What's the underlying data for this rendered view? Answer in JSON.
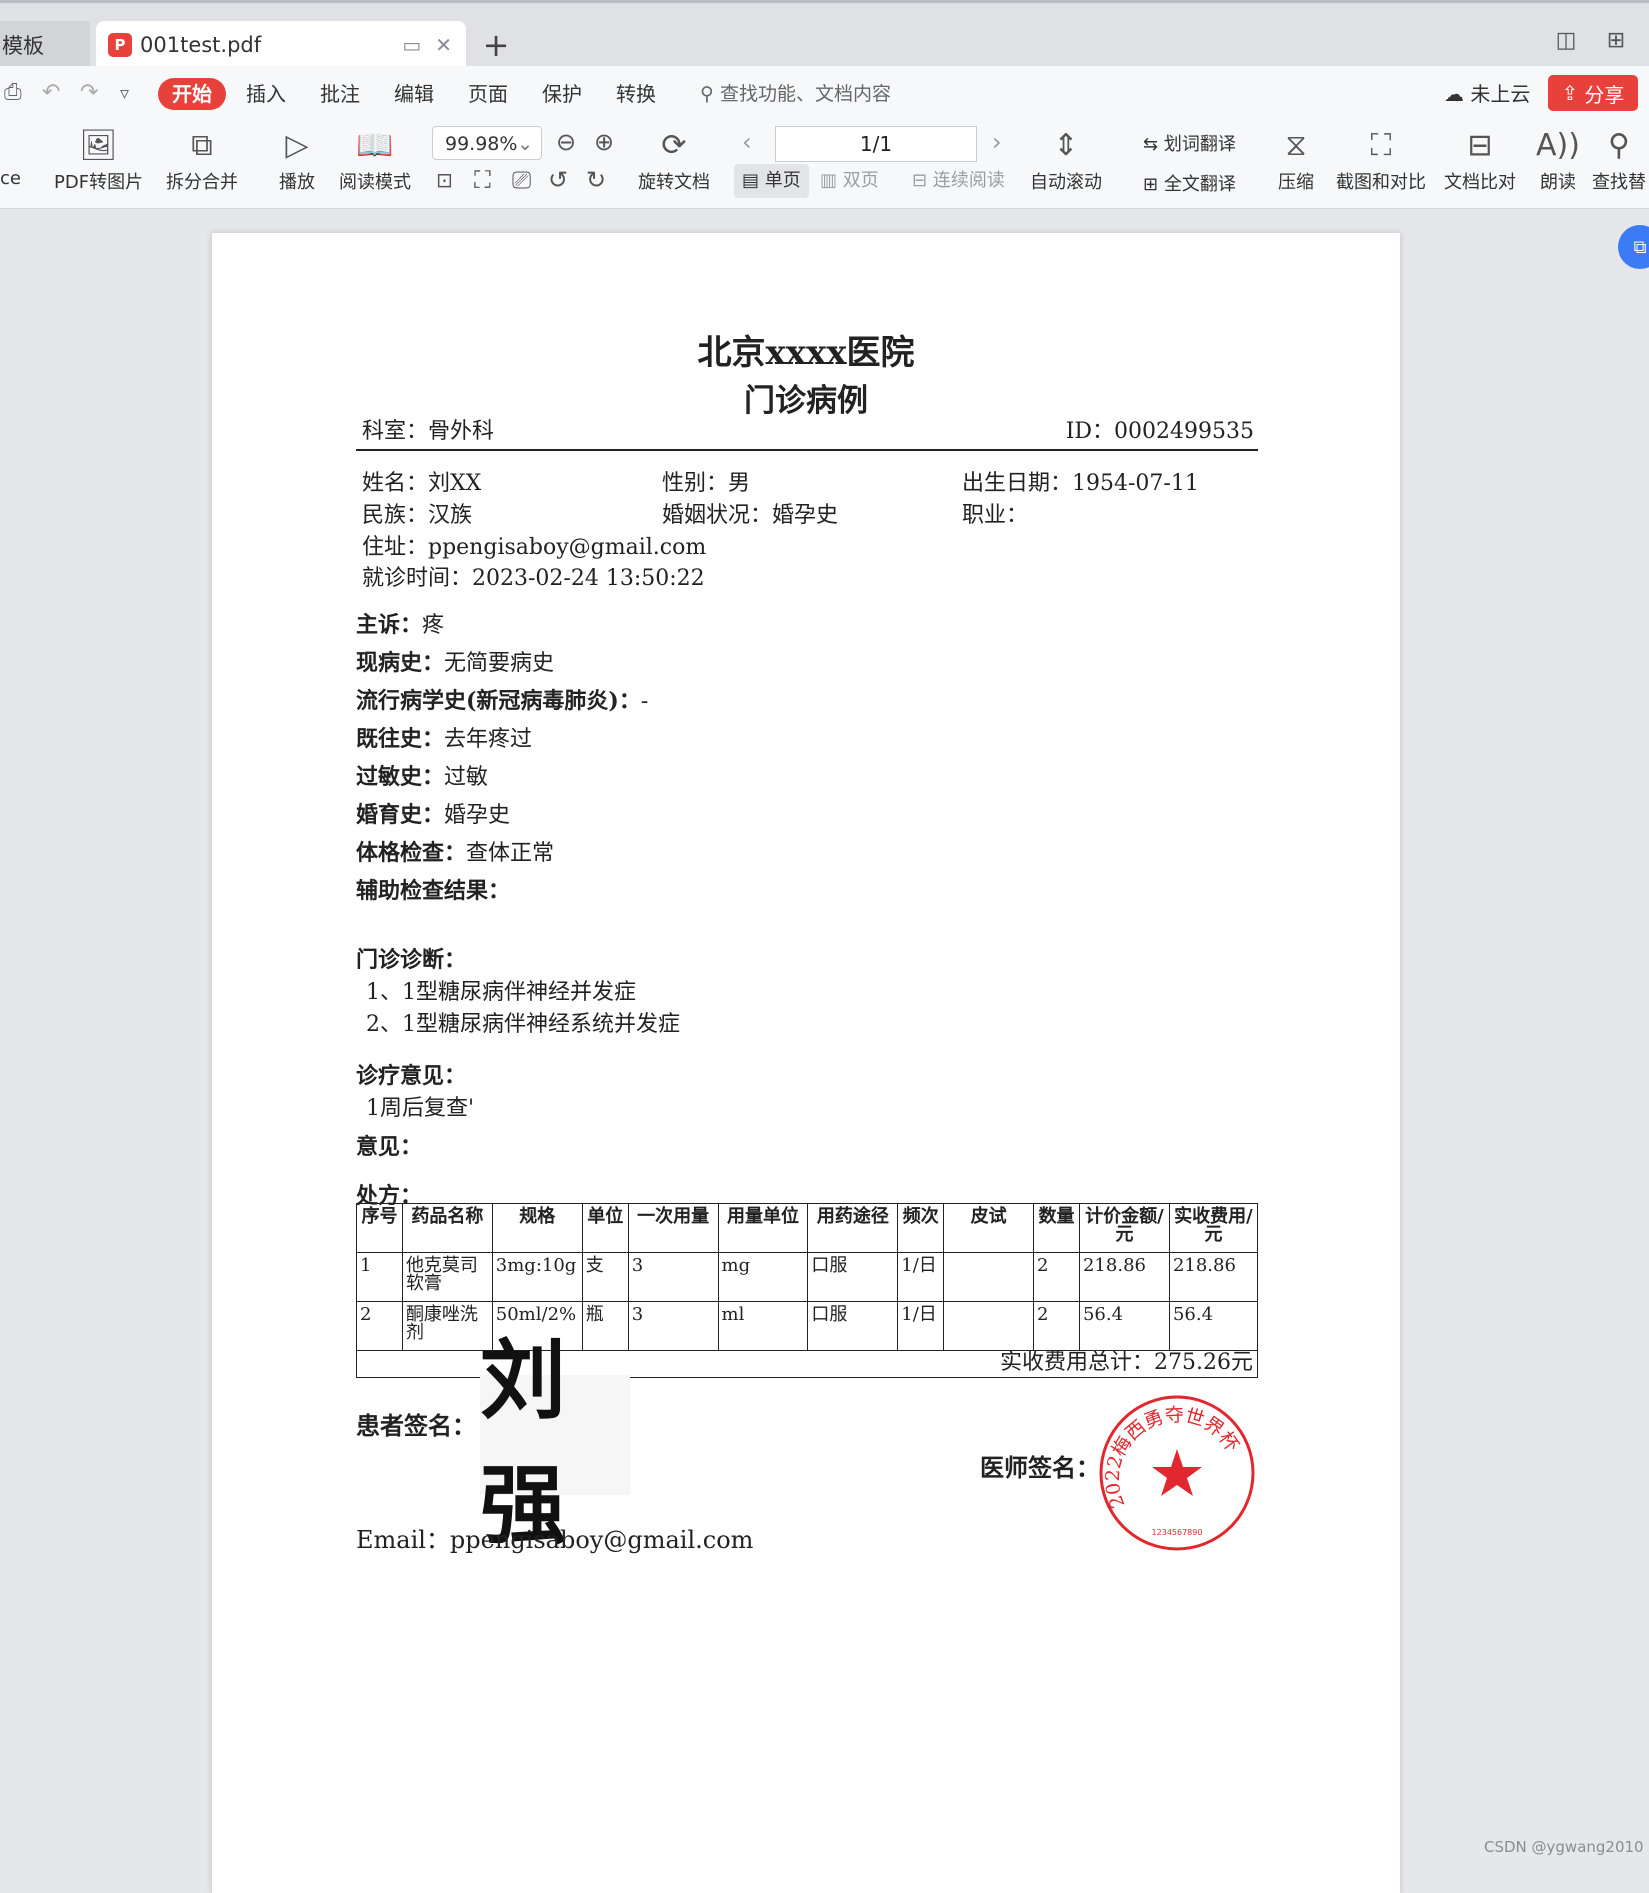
{
  "tabbar": {
    "inactive_tab": "模板",
    "active_tab": "001test.pdf"
  },
  "menu": {
    "items": [
      "开始",
      "插入",
      "批注",
      "编辑",
      "页面",
      "保护",
      "转换"
    ],
    "search_placeholder": "查找功能、文档内容",
    "cloud_label": "未上云",
    "share_label": "分享"
  },
  "toolbar": {
    "office_label": "ce",
    "pdf_to_image": "PDF转图片",
    "split_merge": "拆分合并",
    "play": "播放",
    "read_mode": "阅读模式",
    "zoom_value": "99.98%",
    "rotate_doc": "旋转文档",
    "page_indicator": "1/1",
    "single_page": "单页",
    "double_page": "双页",
    "continuous": "连续阅读",
    "auto_scroll": "自动滚动",
    "word_translate": "划词翻译",
    "full_translate": "全文翻译",
    "compress": "压缩",
    "screenshot_compare": "截图和对比",
    "doc_compare": "文档比对",
    "read_aloud": "朗读",
    "find_replace": "查找替"
  },
  "document": {
    "hospital": "北京xxxx医院",
    "record_title": "门诊病例",
    "department": "科室：骨外科",
    "id": "ID：0002499535",
    "name": "姓名：刘XX",
    "gender": "性别：男",
    "birth": "出生日期：1954-07-11",
    "ethnicity": "民族：汉族",
    "marital": "婚姻状况：婚孕史",
    "occupation": "职业：",
    "address": "住址：ppengisaboy@gmail.com",
    "visit_time": "就诊时间：2023-02-24 13:50:22",
    "sections": [
      {
        "label": "主诉：",
        "value": "疼"
      },
      {
        "label": "现病史：",
        "value": "无简要病史"
      },
      {
        "label": "流行病学史(新冠病毒肺炎)：",
        "value": "-"
      },
      {
        "label": "既往史：",
        "value": "去年疼过"
      },
      {
        "label": "过敏史：",
        "value": "过敏"
      },
      {
        "label": "婚育史：",
        "value": "婚孕史"
      },
      {
        "label": "体格检查：",
        "value": "查体正常"
      },
      {
        "label": "辅助检查结果：",
        "value": ""
      }
    ],
    "diagnosis_label": "门诊诊断：",
    "diagnoses": [
      "1、1型糖尿病伴神经并发症",
      "2、1型糖尿病伴神经系统并发症"
    ],
    "treatment_label": "诊疗意见：",
    "treatment": "1周后复查'",
    "opinion_label": "意见：",
    "rx_label": "处方：",
    "rx_headers": [
      "序号",
      "药品名称",
      "规格",
      "单位",
      "一次用量",
      "用量单位",
      "用药途径",
      "频次",
      "皮试",
      "数量",
      "计价金额/元",
      "实收费用/元"
    ],
    "rx_rows": [
      [
        "1",
        "他克莫司软膏",
        "3mg:10g",
        "支",
        "3",
        "mg",
        "口服",
        "1/日",
        "",
        "2",
        "218.86",
        "218.86"
      ],
      [
        "2",
        "酮康唑洗剂",
        "50ml/2%",
        "瓶",
        "3",
        "ml",
        "口服",
        "1/日",
        "",
        "2",
        "56.4",
        "56.4"
      ]
    ],
    "total": "实收费用总计：275.26元",
    "patient_sig_label": "患者签名：",
    "patient_sig": "刘强",
    "doctor_sig_label": "医师签名：",
    "seal_text": "2022梅西勇夺世界杯",
    "seal_number": "1234567890",
    "email": "Email：ppengisaboy@gmail.com"
  },
  "watermark": "CSDN @ygwang2010",
  "colors": {
    "accent": "#e8413c",
    "seal": "#e0282e",
    "blue": "#3b7cf5"
  }
}
